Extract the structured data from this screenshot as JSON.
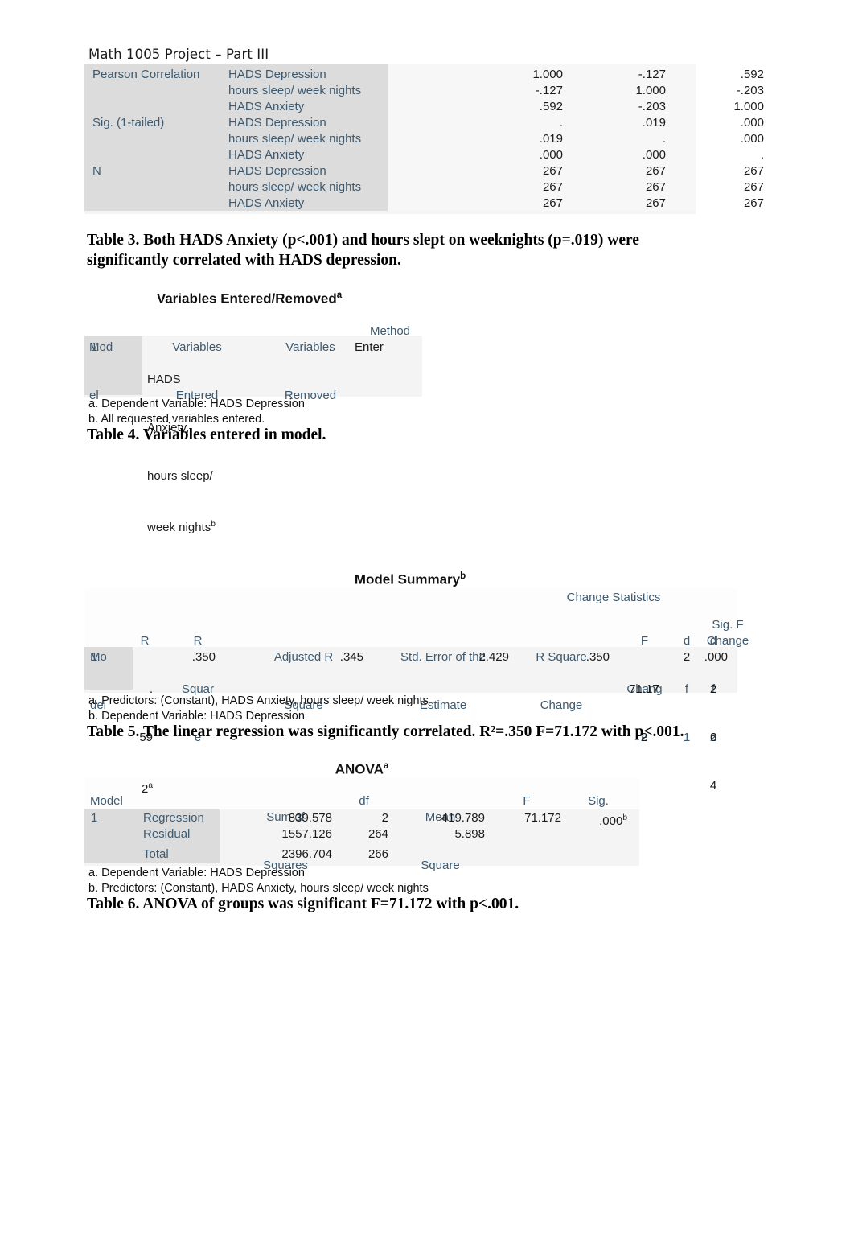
{
  "document": {
    "header": "Math 1005 Project – Part III"
  },
  "correlations_table": {
    "row_groups": [
      {
        "label": "Pearson Correlation",
        "rows": [
          {
            "label": "HADS Depression",
            "values": [
              "1.000",
              "-.127",
              ".592"
            ]
          },
          {
            "label": "hours sleep/ week nights",
            "values": [
              "-.127",
              "1.000",
              "-.203"
            ]
          },
          {
            "label": "HADS Anxiety",
            "values": [
              ".592",
              "-.203",
              "1.000"
            ]
          }
        ]
      },
      {
        "label": "Sig. (1-tailed)",
        "rows": [
          {
            "label": "HADS Depression",
            "values": [
              ".",
              ".019",
              ".000"
            ]
          },
          {
            "label": "hours sleep/ week nights",
            "values": [
              ".019",
              ".",
              ".000"
            ]
          },
          {
            "label": "HADS Anxiety",
            "values": [
              ".000",
              ".000",
              "."
            ]
          }
        ]
      },
      {
        "label": "N",
        "rows": [
          {
            "label": "HADS Depression",
            "values": [
              "267",
              "267",
              "267"
            ]
          },
          {
            "label": "hours sleep/ week nights",
            "values": [
              "267",
              "267",
              "267"
            ]
          },
          {
            "label": "HADS Anxiety",
            "values": [
              "267",
              "267",
              "267"
            ]
          }
        ]
      }
    ]
  },
  "caption3": {
    "line1": "Table 3. Both HADS Anxiety (p<.001) and hours slept on weeknights (p=.019) were",
    "line2": "significantly correlated with HADS depression."
  },
  "variables_table": {
    "title": "Variables Entered/Removed",
    "title_sup": "a",
    "headers": {
      "model_l1": "Mod",
      "model_l2": "el",
      "entered_l1": "Variables",
      "entered_l2": "Entered",
      "removed_l1": "Variables",
      "removed_l2": "Removed",
      "method": "Method"
    },
    "row": {
      "model": "1",
      "entered_l1": "HADS",
      "entered_l2": "Anxiety,",
      "entered_l3": "hours sleep/",
      "entered_l4": "week nights",
      "entered_sup": "b",
      "removed": ".",
      "method": "Enter"
    },
    "footnotes": [
      "a. Dependent Variable: HADS Depression",
      "b. All requested variables entered."
    ]
  },
  "caption4": {
    "line1": "Table 4. Variables entered in model."
  },
  "model_summary": {
    "title": "Model Summary",
    "title_sup": "b",
    "group_header": "Change Statistics",
    "headers": {
      "model_l1": "Mo",
      "model_l2": "del",
      "r": "R",
      "rsq_l1": "R",
      "rsq_l2": "Squar",
      "rsq_l3": "e",
      "adj_l1": "Adjusted R",
      "adj_l2": "Square",
      "see_l1": "Std. Error of the",
      "see_l2": "Estimate",
      "rsqc_l1": "R Square",
      "rsqc_l2": "Change",
      "fchg_l1": "F",
      "fchg_l2": "Chang",
      "fchg_l3": "e",
      "df1_l1": "d",
      "df1_l2": "f",
      "df1_l3": "1",
      "df2_l1": "d",
      "df2_l2": "f",
      "df2_l3": "2",
      "sigf_l1": "Sig. F",
      "sigf_l2": "Change"
    },
    "row": {
      "model": "1",
      "r_l1": ".",
      "r_l2": "59",
      "r_l3": "2",
      "r_sup": "a",
      "r_square": ".350",
      "adjusted_r_square": ".345",
      "std_error": "2.429",
      "r_square_change": ".350",
      "f_change_l1": "71.17",
      "f_change_l2": "2",
      "df1": "2",
      "df2_l1": "2",
      "df2_l2": "6",
      "df2_l3": "4",
      "sig_f_change": ".000"
    },
    "footnotes": [
      "a. Predictors: (Constant), HADS Anxiety, hours sleep/ week nights",
      "b. Dependent Variable: HADS Depression"
    ]
  },
  "caption5": {
    "line1": "Table 5. The linear regression was significantly correlated. R²=.350 F=71.172 with p<.001."
  },
  "anova_table": {
    "title": "ANOVA",
    "title_sup": "a",
    "headers": {
      "model": "Model",
      "ss_l1": "Sum of",
      "ss_l2": "Squares",
      "df": "df",
      "ms_l1": "Mean",
      "ms_l2": "Square",
      "f": "F",
      "sig": "Sig."
    },
    "rows": [
      {
        "model": "1",
        "source": "Regression",
        "ss": "839.578",
        "df": "2",
        "ms": "419.789",
        "f": "71.172",
        "sig": ".000",
        "sig_sup": "b"
      },
      {
        "model": "",
        "source": "Residual",
        "ss": "1557.126",
        "df": "264",
        "ms": "5.898",
        "f": "",
        "sig": "",
        "sig_sup": ""
      },
      {
        "model": "",
        "source": "Total",
        "ss": "2396.704",
        "df": "266",
        "ms": "",
        "f": "",
        "sig": "",
        "sig_sup": ""
      }
    ],
    "footnotes": [
      "a. Dependent Variable: HADS Depression",
      "b. Predictors: (Constant), HADS Anxiety, hours sleep/ week nights"
    ]
  },
  "caption6": {
    "line1": "Table 6. ANOVA of groups was significant F=71.172 with p<.001."
  },
  "colors": {
    "header_text": "#3d5a70",
    "value_text": "#1b1b1b",
    "shade": "#dcdcdc",
    "zone": "#f3f3f3",
    "page": "#ffffff"
  }
}
